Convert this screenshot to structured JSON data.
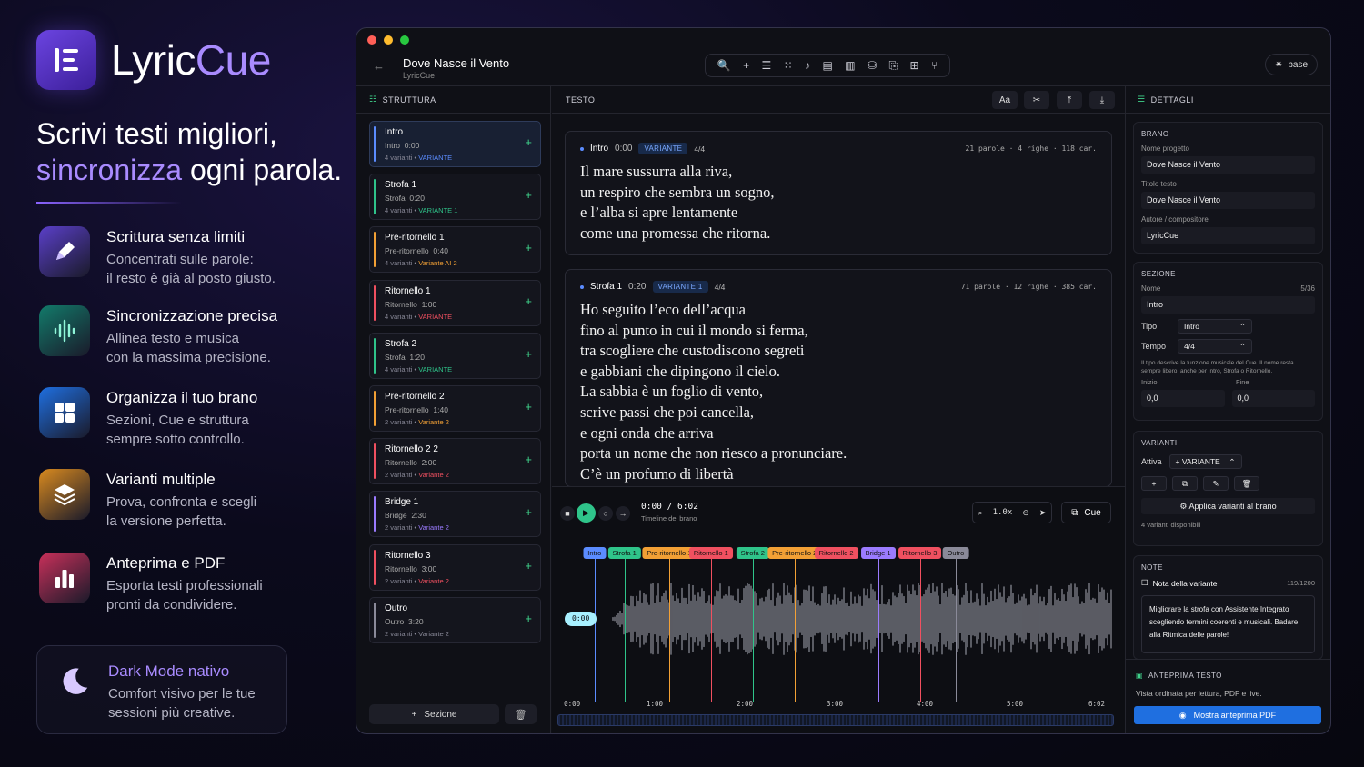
{
  "brand": {
    "name_a": "Lyric",
    "name_b": "Cue"
  },
  "headline": {
    "line1": "Scrivi testi migliori,",
    "line2_hl": "sincronizza",
    "line2_rest": " ogni parola."
  },
  "features": [
    {
      "title": "Scrittura senza limiti",
      "d1": "Concentrati sulle parole:",
      "d2": "il resto è già al posto giusto.",
      "icon": "pencil-icon",
      "color": "#5a3fc8"
    },
    {
      "title": "Sincronizzazione precisa",
      "d1": "Allinea testo e musica",
      "d2": "con la massima precisione.",
      "icon": "waveform-icon",
      "color": "#127a6a"
    },
    {
      "title": "Organizza il tuo brano",
      "d1": "Sezioni, Cue e struttura",
      "d2": "sempre sotto controllo.",
      "icon": "grid-icon",
      "color": "#1f6fe0"
    },
    {
      "title": "Varianti multiple",
      "d1": "Prova, confronta e scegli",
      "d2": "la versione perfetta.",
      "icon": "layers-icon",
      "color": "#d98a1f"
    },
    {
      "title": "Anteprima e PDF",
      "d1": "Esporta testi professionali",
      "d2": "pronti da condividere.",
      "icon": "bar-chart-icon",
      "color": "#c8305a"
    }
  ],
  "darkmode": {
    "title": "Dark Mode nativo",
    "d1": "Comfort visivo per le tue",
    "d2": "sessioni più creative."
  },
  "window": {
    "back": "←",
    "title": "Dove Nasce il Vento",
    "subtitle": "LyricCue",
    "base_label": "base"
  },
  "toolbar_icons": [
    "🔍",
    "+",
    "☰",
    "⁙",
    "♪",
    "▤",
    "▥",
    "⛁",
    "⎘",
    "⊞",
    "⑂"
  ],
  "panels": {
    "structure": "STRUTTURA",
    "text": "TESTO",
    "details": "DETTAGLI"
  },
  "text_tools": [
    "Aa",
    "✂",
    "⤒",
    "⤓"
  ],
  "sections": [
    {
      "name": "Intro",
      "type": "Intro",
      "time": "0:00",
      "v": "4 varianti",
      "vsel": "VARIANTE",
      "color": "#5b8cff",
      "hl": "#5b8cff",
      "active": true
    },
    {
      "name": "Strofa 1",
      "type": "Strofa",
      "time": "0:20",
      "v": "4 varianti",
      "vsel": "VARIANTE 1",
      "color": "#2fc48a",
      "hl": "#2fc48a"
    },
    {
      "name": "Pre-ritornello 1",
      "type": "Pre-ritornello",
      "time": "0:40",
      "v": "4 varianti",
      "vsel": "Variante AI 2",
      "color": "#f2a035",
      "hl": "#f2a035"
    },
    {
      "name": "Ritornello 1",
      "type": "Ritornello",
      "time": "1:00",
      "v": "4 varianti",
      "vsel": "VARIANTE",
      "color": "#f05060",
      "hl": "#f05060"
    },
    {
      "name": "Strofa 2",
      "type": "Strofa",
      "time": "1:20",
      "v": "4 varianti",
      "vsel": "VARIANTE",
      "color": "#2fc48a",
      "hl": "#2fc48a"
    },
    {
      "name": "Pre-ritornello 2",
      "type": "Pre-ritornello",
      "time": "1:40",
      "v": "2 varianti",
      "vsel": "Variante 2",
      "color": "#f2a035",
      "hl": "#f2a035"
    },
    {
      "name": "Ritornello 2 2",
      "type": "Ritornello",
      "time": "2:00",
      "v": "2 varianti",
      "vsel": "Variante 2",
      "color": "#f05060",
      "hl": "#f05060"
    },
    {
      "name": "Bridge 1",
      "type": "Bridge",
      "time": "2:30",
      "v": "2 varianti",
      "vsel": "Variante 2",
      "color": "#9b7bff",
      "hl": "#9b7bff"
    },
    {
      "name": "Ritornello 3",
      "type": "Ritornello",
      "time": "3:00",
      "v": "2 varianti",
      "vsel": "Variante 2",
      "color": "#f05060",
      "hl": "#f05060"
    },
    {
      "name": "Outro",
      "type": "Outro",
      "time": "3:20",
      "v": "2 varianti",
      "vsel": "Variante 2",
      "color": "#8a8a99",
      "hl": "#8a8a99"
    }
  ],
  "add_section": "Sezione",
  "lyrics": [
    {
      "name": "Intro",
      "time": "0:00",
      "tag": "VARIANTE",
      "meter": "4/4",
      "stats": "21 parole · 4 righe · 118 car.",
      "lines": [
        "Il mare sussurra alla riva,",
        "un respiro che sembra un sogno,",
        "e l’alba si apre lentamente",
        "come una promessa che ritorna."
      ]
    },
    {
      "name": "Strofa 1",
      "time": "0:20",
      "tag": "VARIANTE 1",
      "meter": "4/4",
      "stats": "71 parole · 12 righe · 385 car.",
      "lines": [
        "Ho seguito l’eco dell’acqua",
        "fino al punto in cui il mondo si ferma,",
        "tra scogliere che custodiscono segreti",
        "e gabbiani che dipingono il cielo.",
        "La sabbia è un foglio di vento,",
        "scrive passi che poi cancella,",
        "e ogni onda che arriva",
        "porta un nome che non riesco a pronunciare.",
        "C’è un profumo di libertà"
      ]
    }
  ],
  "player": {
    "time": "0:00 / 6:02",
    "sub": "Timeline del brano",
    "speed": "1.0x",
    "cue": "Cue",
    "playhead": "0:00"
  },
  "timeline": {
    "duration_s": 362,
    "markers": [
      {
        "label": "Intro",
        "t": 20,
        "color": "#5b8cff"
      },
      {
        "label": "Strofa 1",
        "t": 40,
        "color": "#2fc48a"
      },
      {
        "label": "Pre-ritornello 1",
        "t": 70,
        "color": "#f2a035"
      },
      {
        "label": "Ritornello 1",
        "t": 98,
        "color": "#f05060"
      },
      {
        "label": "Strofa 2",
        "t": 126,
        "color": "#2fc48a"
      },
      {
        "label": "Pre-ritornello 2",
        "t": 154,
        "color": "#f2a035"
      },
      {
        "label": "Ritornello 2",
        "t": 182,
        "color": "#f05060"
      },
      {
        "label": "Bridge 1",
        "t": 210,
        "color": "#9b7bff"
      },
      {
        "label": "Ritornello 3",
        "t": 238,
        "color": "#f05060"
      },
      {
        "label": "Outro",
        "t": 262,
        "color": "#8a8a99"
      }
    ],
    "ticks": [
      "0:00",
      "1:00",
      "2:00",
      "3:00",
      "4:00",
      "5:00",
      "6:02"
    ]
  },
  "details": {
    "brano": {
      "label": "BRANO",
      "proj_l": "Nome progetto",
      "proj": "Dove Nasce il Vento",
      "title_l": "Titolo testo",
      "title": "Dove Nasce il Vento",
      "author_l": "Autore / compositore",
      "author": "LyricCue"
    },
    "sezione": {
      "label": "SEZIONE",
      "name_l": "Nome",
      "count": "5/36",
      "name": "Intro",
      "tipo_l": "Tipo",
      "tipo": "Intro",
      "tempo_l": "Tempo",
      "tempo": "4/4",
      "help": "Il tipo descrive la funzione musicale del Cue. Il nome resta sempre libero, anche per Intro, Strofa o Ritornello.",
      "inizio_l": "Inizio",
      "inizio": "0,0",
      "fine_l": "Fine",
      "fine": "0,0"
    },
    "varianti": {
      "label": "VARIANTI",
      "attiva_l": "Attiva",
      "attiva": "+ VARIANTE",
      "apply": "Applica varianti al brano",
      "count": "4 varianti disponibili"
    },
    "note": {
      "label": "NOTE",
      "title": "Nota della variante",
      "count": "119/1200",
      "text": "Migliorare la strofa con Assistente Integrato scegliendo termini coerenti e musicali. Badare alla Ritmica delle parole!"
    },
    "preview": {
      "label": "ANTEPRIMA TESTO",
      "desc": "Vista ordinata per lettura, PDF e live.",
      "btn": "Mostra anteprima PDF"
    }
  }
}
